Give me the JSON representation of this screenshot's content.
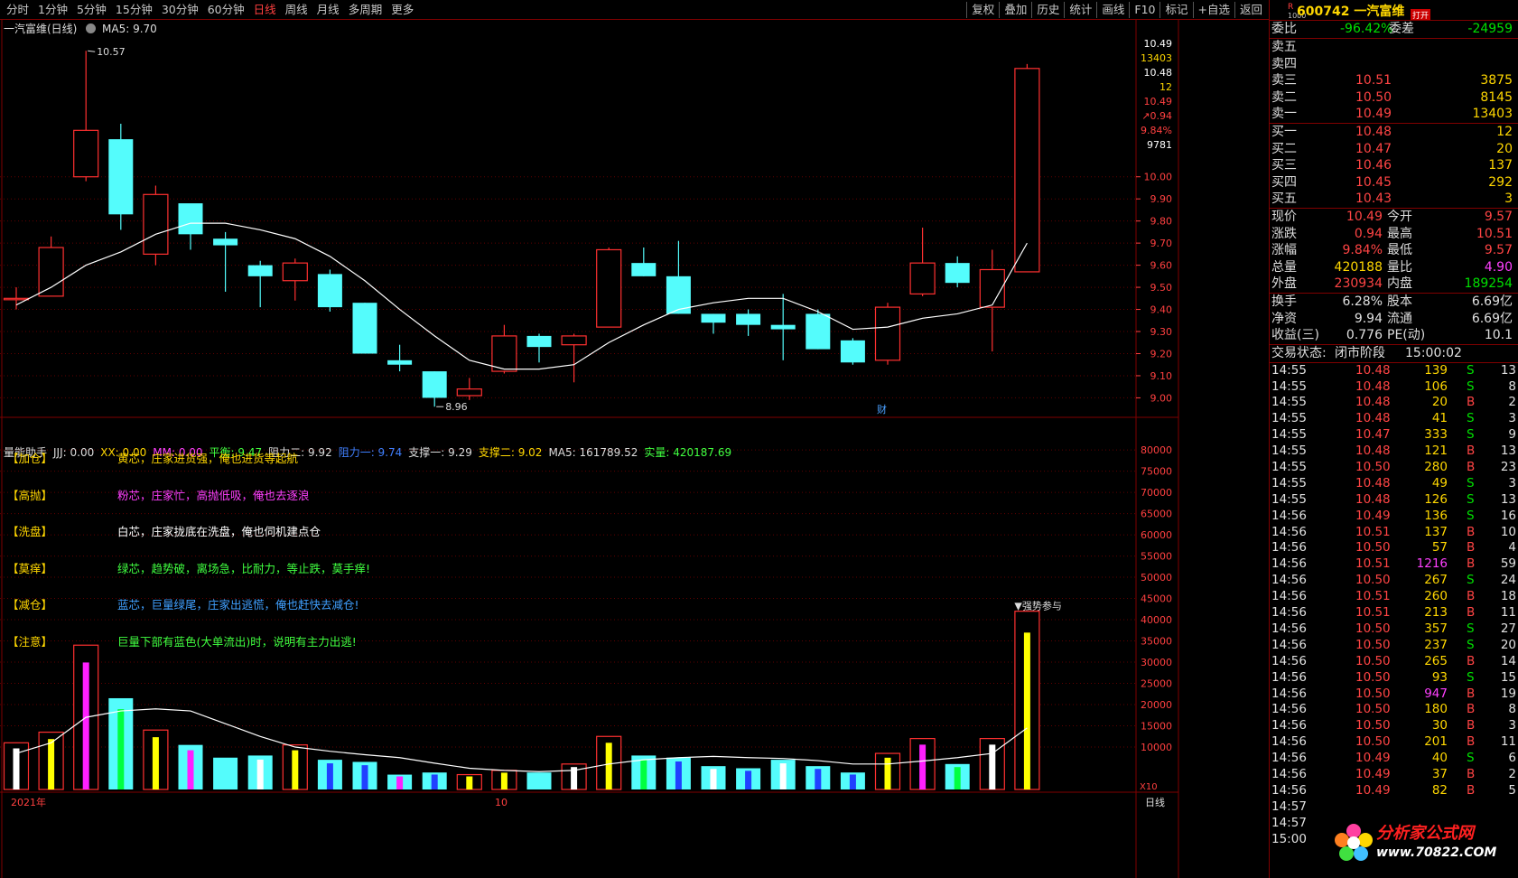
{
  "toolbar": {
    "periods": [
      "分时",
      "1分钟",
      "5分钟",
      "15分钟",
      "30分钟",
      "60分钟",
      "日线",
      "周线",
      "月线",
      "多周期",
      "更多"
    ],
    "active_period": "日线",
    "actions": [
      "复权",
      "叠加",
      "历史",
      "统计",
      "画线",
      "F10",
      "标记",
      "+自选",
      "返回"
    ]
  },
  "chart_title": "一汽富维(日线)",
  "ma_label": "MA5: 9.70",
  "annotations": {
    "high": "10.57",
    "low": "8.96",
    "event": "财",
    "strong": "▼强势参与"
  },
  "indicator_bar": [
    {
      "text": "量能助手",
      "color": "#dddddd"
    },
    {
      "text": "JJJ: 0.00",
      "color": "#dddddd"
    },
    {
      "text": "XX: 0.00",
      "color": "#ffd700"
    },
    {
      "text": "MM: 0.00",
      "color": "#ff40ff"
    },
    {
      "text": "平衡: 9.47",
      "color": "#40ff40"
    },
    {
      "text": "阻力二: 9.92",
      "color": "#dddddd"
    },
    {
      "text": "阻力一: 9.74",
      "color": "#4080ff"
    },
    {
      "text": "支撑一: 9.29",
      "color": "#dddddd"
    },
    {
      "text": "支撑二: 9.02",
      "color": "#ffd700"
    },
    {
      "text": "MA5: 161789.52",
      "color": "#dddddd"
    },
    {
      "text": "实量: 420187.69",
      "color": "#40ff40"
    }
  ],
  "legend": [
    {
      "tag": "【加仓】",
      "text": "黄芯，庄家进货强，俺也进货等起航",
      "color": "#ffd700"
    },
    {
      "tag": "【高抛】",
      "text": "粉芯，庄家忙，高抛低吸，俺也去逐浪",
      "color": "#ff40ff"
    },
    {
      "tag": "【洗盘】",
      "text": "白芯，庄家拢底在洗盘，俺也伺机建点仓",
      "color": "#ffffff"
    },
    {
      "tag": "【莫痒】",
      "text": "绿芯，趋势破，离场急，比耐力，等止跌，莫手痒!",
      "color": "#40ff40"
    },
    {
      "tag": "【减仓】",
      "text": "蓝芯，巨量绿尾，庄家出逃慌，俺也赶快去减仓!",
      "color": "#40a0ff"
    },
    {
      "tag": "【注意】",
      "text": "巨量下部有蓝色(大单流出)时，说明有主力出逃!",
      "color": "#40ff40"
    }
  ],
  "price_axis": {
    "ticks": [
      "10.00",
      "9.90",
      "9.80",
      "9.70",
      "9.60",
      "9.50",
      "9.40",
      "9.30",
      "9.20",
      "9.10",
      "9.00"
    ],
    "top_labels": [
      {
        "t": "10.49",
        "c": "#ffffff"
      },
      {
        "t": "13403",
        "c": "#ffd700"
      },
      {
        "t": "10.48",
        "c": "#ffffff"
      },
      {
        "t": "12",
        "c": "#ffd700"
      },
      {
        "t": "10.49",
        "c": "#ff4040"
      },
      {
        "t": "↗0.94",
        "c": "#ff4040"
      },
      {
        "t": "9.84%",
        "c": "#ff4040"
      },
      {
        "t": "9781",
        "c": "#ffffff"
      }
    ]
  },
  "volume_axis": {
    "ticks": [
      "80000",
      "75000",
      "70000",
      "65000",
      "60000",
      "55000",
      "50000",
      "45000",
      "40000",
      "35000",
      "30000",
      "25000",
      "20000",
      "15000",
      "10000"
    ],
    "unit": "X10"
  },
  "date_axis": {
    "labels": [
      "2021年",
      "10"
    ],
    "period": "日线"
  },
  "chart_data": {
    "type": "candlestick",
    "candles": [
      {
        "o": 9.45,
        "c": 9.45,
        "h": 9.5,
        "l": 9.4
      },
      {
        "o": 9.46,
        "c": 9.68,
        "h": 9.73,
        "l": 9.46
      },
      {
        "o": 10.0,
        "c": 10.21,
        "h": 10.57,
        "l": 9.98
      },
      {
        "o": 10.17,
        "c": 9.83,
        "h": 10.24,
        "l": 9.76
      },
      {
        "o": 9.65,
        "c": 9.92,
        "h": 9.96,
        "l": 9.6
      },
      {
        "o": 9.88,
        "c": 9.74,
        "h": 9.84,
        "l": 9.67
      },
      {
        "o": 9.72,
        "c": 9.69,
        "h": 9.75,
        "l": 9.48
      },
      {
        "o": 9.6,
        "c": 9.55,
        "h": 9.62,
        "l": 9.41
      },
      {
        "o": 9.53,
        "c": 9.61,
        "h": 9.63,
        "l": 9.44
      },
      {
        "o": 9.56,
        "c": 9.41,
        "h": 9.58,
        "l": 9.39
      },
      {
        "o": 9.43,
        "c": 9.2,
        "h": 9.43,
        "l": 9.2
      },
      {
        "o": 9.17,
        "c": 9.15,
        "h": 9.24,
        "l": 9.12
      },
      {
        "o": 9.12,
        "c": 9.0,
        "h": 9.12,
        "l": 8.96
      },
      {
        "o": 9.01,
        "c": 9.04,
        "h": 9.09,
        "l": 8.99
      },
      {
        "o": 9.12,
        "c": 9.28,
        "h": 9.33,
        "l": 9.11
      },
      {
        "o": 9.28,
        "c": 9.23,
        "h": 9.29,
        "l": 9.16
      },
      {
        "o": 9.24,
        "c": 9.28,
        "h": 9.29,
        "l": 9.07
      },
      {
        "o": 9.32,
        "c": 9.67,
        "h": 9.68,
        "l": 9.32
      },
      {
        "o": 9.61,
        "c": 9.55,
        "h": 9.68,
        "l": 9.55
      },
      {
        "o": 9.55,
        "c": 9.38,
        "h": 9.71,
        "l": 9.38
      },
      {
        "o": 9.38,
        "c": 9.34,
        "h": 9.38,
        "l": 9.29
      },
      {
        "o": 9.38,
        "c": 9.33,
        "h": 9.4,
        "l": 9.28
      },
      {
        "o": 9.33,
        "c": 9.31,
        "h": 9.47,
        "l": 9.17
      },
      {
        "o": 9.38,
        "c": 9.22,
        "h": 9.4,
        "l": 9.22
      },
      {
        "o": 9.26,
        "c": 9.16,
        "h": 9.27,
        "l": 9.15
      },
      {
        "o": 9.17,
        "c": 9.41,
        "h": 9.43,
        "l": 9.15
      },
      {
        "o": 9.47,
        "c": 9.61,
        "h": 9.77,
        "l": 9.46
      },
      {
        "o": 9.61,
        "c": 9.52,
        "h": 9.64,
        "l": 9.5
      },
      {
        "o": 9.41,
        "c": 9.58,
        "h": 9.67,
        "l": 9.21
      },
      {
        "o": 9.57,
        "c": 10.49,
        "h": 10.51,
        "l": 9.57
      }
    ],
    "ma5": [
      9.42,
      9.5,
      9.6,
      9.66,
      9.74,
      9.79,
      9.79,
      9.76,
      9.72,
      9.64,
      9.53,
      9.4,
      9.28,
      9.17,
      9.13,
      9.13,
      9.15,
      9.25,
      9.33,
      9.4,
      9.43,
      9.45,
      9.45,
      9.39,
      9.31,
      9.32,
      9.36,
      9.38,
      9.42,
      9.7
    ],
    "volume": [
      {
        "v": 11000,
        "core": "white"
      },
      {
        "v": 13500,
        "core": "yellow"
      },
      {
        "v": 34000,
        "core": "magenta"
      },
      {
        "v": 21500,
        "core": "green"
      },
      {
        "v": 14000,
        "core": "yellow"
      },
      {
        "v": 10500,
        "core": "magenta"
      },
      {
        "v": 7500,
        "core": "none"
      },
      {
        "v": 8000,
        "core": "white"
      },
      {
        "v": 10500,
        "core": "yellow"
      },
      {
        "v": 7000,
        "core": "blue"
      },
      {
        "v": 6500,
        "core": "blue"
      },
      {
        "v": 3500,
        "core": "magenta"
      },
      {
        "v": 4000,
        "core": "blue"
      },
      {
        "v": 3500,
        "core": "yellow"
      },
      {
        "v": 4500,
        "core": "yellow"
      },
      {
        "v": 4000,
        "core": "none"
      },
      {
        "v": 6000,
        "core": "white"
      },
      {
        "v": 12500,
        "core": "yellow"
      },
      {
        "v": 8000,
        "core": "green"
      },
      {
        "v": 7500,
        "core": "blue"
      },
      {
        "v": 5500,
        "core": "white"
      },
      {
        "v": 5000,
        "core": "blue"
      },
      {
        "v": 7000,
        "core": "white"
      },
      {
        "v": 5500,
        "core": "blue"
      },
      {
        "v": 4000,
        "core": "blue"
      },
      {
        "v": 8500,
        "core": "yellow"
      },
      {
        "v": 12000,
        "core": "magenta"
      },
      {
        "v": 6000,
        "core": "green"
      },
      {
        "v": 12000,
        "core": "white"
      },
      {
        "v": 42000,
        "core": "yellow"
      }
    ],
    "vol_ma": [
      8500,
      11000,
      17000,
      18500,
      19000,
      18500,
      15500,
      12500,
      10000,
      9000,
      8200,
      7500,
      6200,
      5000,
      4500,
      4200,
      4500,
      6000,
      7000,
      7500,
      7800,
      7500,
      7300,
      6800,
      6000,
      6000,
      6700,
      7500,
      8500,
      14500
    ],
    "price_ylim": [
      8.92,
      10.62
    ],
    "vol_ylim": [
      0,
      83000
    ]
  },
  "stock": {
    "r": "R",
    "r2": "1000",
    "code": "600742",
    "name": "一汽富维",
    "open_tag": "打开"
  },
  "weibi": {
    "label1": "委比",
    "v1": "-96.42%",
    "label2": "委差",
    "v2": "-24959"
  },
  "sells": [
    {
      "label": "卖五",
      "price": "",
      "vol": ""
    },
    {
      "label": "卖四",
      "price": "",
      "vol": ""
    },
    {
      "label": "卖三",
      "price": "10.51",
      "vol": "3875"
    },
    {
      "label": "卖二",
      "price": "10.50",
      "vol": "8145"
    },
    {
      "label": "卖一",
      "price": "10.49",
      "vol": "13403"
    }
  ],
  "buys": [
    {
      "label": "买一",
      "price": "10.48",
      "vol": "12"
    },
    {
      "label": "买二",
      "price": "10.47",
      "vol": "20"
    },
    {
      "label": "买三",
      "price": "10.46",
      "vol": "137"
    },
    {
      "label": "买四",
      "price": "10.45",
      "vol": "292"
    },
    {
      "label": "买五",
      "price": "10.43",
      "vol": "3"
    }
  ],
  "quote": [
    {
      "l1": "现价",
      "v1": "10.49",
      "c1": "red",
      "l2": "今开",
      "v2": "9.57",
      "c2": "red"
    },
    {
      "l1": "涨跌",
      "v1": "0.94",
      "c1": "red",
      "l2": "最高",
      "v2": "10.51",
      "c2": "red"
    },
    {
      "l1": "涨幅",
      "v1": "9.84%",
      "c1": "red",
      "l2": "最低",
      "v2": "9.57",
      "c2": "red"
    },
    {
      "l1": "总量",
      "v1": "420188",
      "c1": "yel",
      "l2": "量比",
      "v2": "4.90",
      "c2": "mag"
    },
    {
      "l1": "外盘",
      "v1": "230934",
      "c1": "red",
      "l2": "内盘",
      "v2": "189254",
      "c2": "green"
    }
  ],
  "quote2": [
    {
      "l1": "换手",
      "v1": "6.28%",
      "l2": "股本",
      "v2": "6.69亿"
    },
    {
      "l1": "净资",
      "v1": "9.94",
      "l2": "流通",
      "v2": "6.69亿"
    },
    {
      "l1": "收益(三)",
      "v1": "0.776",
      "l2": "PE(动)",
      "v2": "10.1"
    }
  ],
  "status": {
    "label": "交易状态:",
    "state": "闭市阶段",
    "time": "15:00:02"
  },
  "ticks": [
    {
      "t": "14:55",
      "p": "10.48",
      "v": "139",
      "d": "S",
      "n": "13"
    },
    {
      "t": "14:55",
      "p": "10.48",
      "v": "106",
      "d": "S",
      "n": "8"
    },
    {
      "t": "14:55",
      "p": "10.48",
      "v": "20",
      "d": "B",
      "n": "2"
    },
    {
      "t": "14:55",
      "p": "10.48",
      "v": "41",
      "d": "S",
      "n": "3"
    },
    {
      "t": "14:55",
      "p": "10.47",
      "v": "333",
      "d": "S",
      "n": "9"
    },
    {
      "t": "14:55",
      "p": "10.48",
      "v": "121",
      "d": "B",
      "n": "13"
    },
    {
      "t": "14:55",
      "p": "10.50",
      "v": "280",
      "d": "B",
      "n": "23"
    },
    {
      "t": "14:55",
      "p": "10.48",
      "v": "49",
      "d": "S",
      "n": "3"
    },
    {
      "t": "14:55",
      "p": "10.48",
      "v": "126",
      "d": "S",
      "n": "13"
    },
    {
      "t": "14:56",
      "p": "10.49",
      "v": "136",
      "d": "S",
      "n": "16"
    },
    {
      "t": "14:56",
      "p": "10.51",
      "v": "137",
      "d": "B",
      "n": "10"
    },
    {
      "t": "14:56",
      "p": "10.50",
      "v": "57",
      "d": "B",
      "n": "4"
    },
    {
      "t": "14:56",
      "p": "10.51",
      "v": "1216",
      "d": "B",
      "n": "59"
    },
    {
      "t": "14:56",
      "p": "10.50",
      "v": "267",
      "d": "S",
      "n": "24"
    },
    {
      "t": "14:56",
      "p": "10.51",
      "v": "260",
      "d": "B",
      "n": "18"
    },
    {
      "t": "14:56",
      "p": "10.51",
      "v": "213",
      "d": "B",
      "n": "11"
    },
    {
      "t": "14:56",
      "p": "10.50",
      "v": "357",
      "d": "S",
      "n": "27"
    },
    {
      "t": "14:56",
      "p": "10.50",
      "v": "237",
      "d": "S",
      "n": "20"
    },
    {
      "t": "14:56",
      "p": "10.50",
      "v": "265",
      "d": "B",
      "n": "14"
    },
    {
      "t": "14:56",
      "p": "10.50",
      "v": "93",
      "d": "S",
      "n": "15"
    },
    {
      "t": "14:56",
      "p": "10.50",
      "v": "947",
      "d": "B",
      "n": "19"
    },
    {
      "t": "14:56",
      "p": "10.50",
      "v": "180",
      "d": "B",
      "n": "8"
    },
    {
      "t": "14:56",
      "p": "10.50",
      "v": "30",
      "d": "B",
      "n": "3"
    },
    {
      "t": "14:56",
      "p": "10.50",
      "v": "201",
      "d": "B",
      "n": "11"
    },
    {
      "t": "14:56",
      "p": "10.49",
      "v": "40",
      "d": "S",
      "n": "6"
    },
    {
      "t": "14:56",
      "p": "10.49",
      "v": "37",
      "d": "B",
      "n": "2"
    },
    {
      "t": "14:56",
      "p": "10.49",
      "v": "82",
      "d": "B",
      "n": "5"
    },
    {
      "t": "14:57",
      "p": "",
      "v": "",
      "d": "",
      "n": ""
    },
    {
      "t": "14:57",
      "p": "",
      "v": "",
      "d": "",
      "n": ""
    },
    {
      "t": "15:00",
      "p": "",
      "v": "",
      "d": "",
      "n": ""
    }
  ],
  "logo": {
    "name": "分析家公式网",
    "url": "www.70822.COM"
  },
  "colors": {
    "up": "#ff3030",
    "down": "#54fcfc",
    "ma": "#ffffff",
    "grid": "#800000"
  }
}
